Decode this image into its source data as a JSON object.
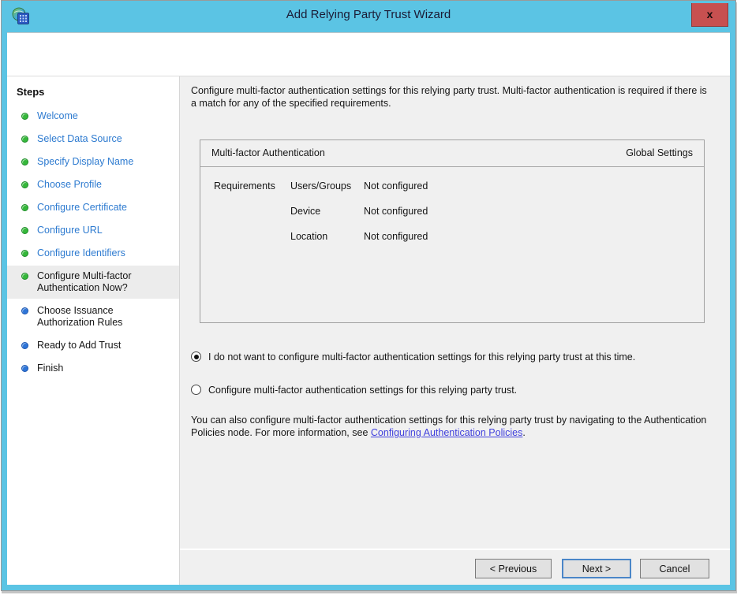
{
  "window": {
    "title": "Add Relying Party Trust Wizard",
    "close_label": "x"
  },
  "colors": {
    "titlebar_blue": "#5bc4e4",
    "close_button_red": "#c75050",
    "content_bg": "#f0f0f0",
    "step_done_link": "#2e7bd0",
    "bullet_done_green": "#35b83a",
    "bullet_upcoming_blue": "#2d75d8",
    "hyperlink": "#4040dd",
    "default_button_border": "#4a86c8"
  },
  "sidebar": {
    "heading": "Steps",
    "steps": [
      {
        "label": "Welcome",
        "state": "done"
      },
      {
        "label": "Select Data Source",
        "state": "done"
      },
      {
        "label": "Specify Display Name",
        "state": "done"
      },
      {
        "label": "Choose Profile",
        "state": "done"
      },
      {
        "label": "Configure Certificate",
        "state": "done"
      },
      {
        "label": "Configure URL",
        "state": "done"
      },
      {
        "label": "Configure Identifiers",
        "state": "done"
      },
      {
        "label": "Configure Multi-factor Authentication Now?",
        "state": "current"
      },
      {
        "label": "Choose Issuance Authorization Rules",
        "state": "upcoming"
      },
      {
        "label": "Ready to Add Trust",
        "state": "upcoming"
      },
      {
        "label": "Finish",
        "state": "upcoming"
      }
    ]
  },
  "main": {
    "intro": "Configure multi-factor authentication settings for this relying party trust. Multi-factor authentication is required if there is a match for any of the specified requirements.",
    "panel": {
      "header_left": "Multi-factor Authentication",
      "header_right": "Global Settings",
      "rows": [
        {
          "group": "Requirements",
          "item": "Users/Groups",
          "value": "Not configured"
        },
        {
          "group": "",
          "item": "Device",
          "value": "Not configured"
        },
        {
          "group": "",
          "item": "Location",
          "value": "Not configured"
        }
      ]
    },
    "options": [
      {
        "label": "I do not want to configure multi-factor authentication settings for this relying party trust at this time.",
        "selected": true
      },
      {
        "label": "Configure multi-factor authentication settings for this relying party trust.",
        "selected": false
      }
    ],
    "footnote_before": "You can also configure multi-factor authentication settings for this relying party trust by navigating to the Authentication Policies node. For more information, see ",
    "footnote_link": "Configuring Authentication Policies",
    "footnote_after": "."
  },
  "footer": {
    "buttons": [
      {
        "label": "< Previous",
        "default": false
      },
      {
        "label": "Next >",
        "default": true
      },
      {
        "label": "Cancel",
        "default": false
      }
    ]
  }
}
